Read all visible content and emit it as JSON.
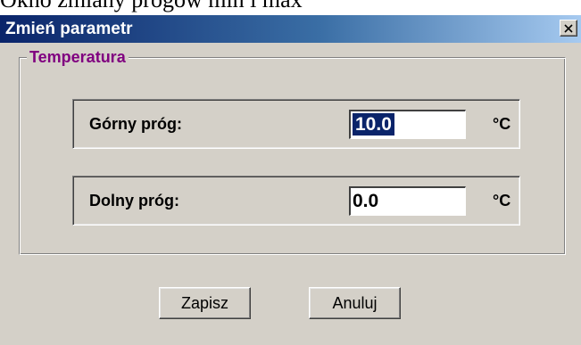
{
  "caption": "Okno zmiany progów min i max",
  "window": {
    "title": "Zmień parametr"
  },
  "group": {
    "legend": "Temperatura"
  },
  "upper_threshold": {
    "label": "Górny próg:",
    "value": "10.0",
    "unit": "°C",
    "selected": true
  },
  "lower_threshold": {
    "label": "Dolny próg:",
    "value": "0.0",
    "unit": "°C"
  },
  "buttons": {
    "save_label": "Zapisz",
    "cancel_label": "Anuluj"
  },
  "icons": {
    "close": "close-icon"
  },
  "colors": {
    "titlebar_start": "#0a246a",
    "titlebar_end": "#a6caf0",
    "dialog_bg": "#d4d0c8",
    "legend_text": "#800080",
    "selection_bg": "#0a246a"
  }
}
